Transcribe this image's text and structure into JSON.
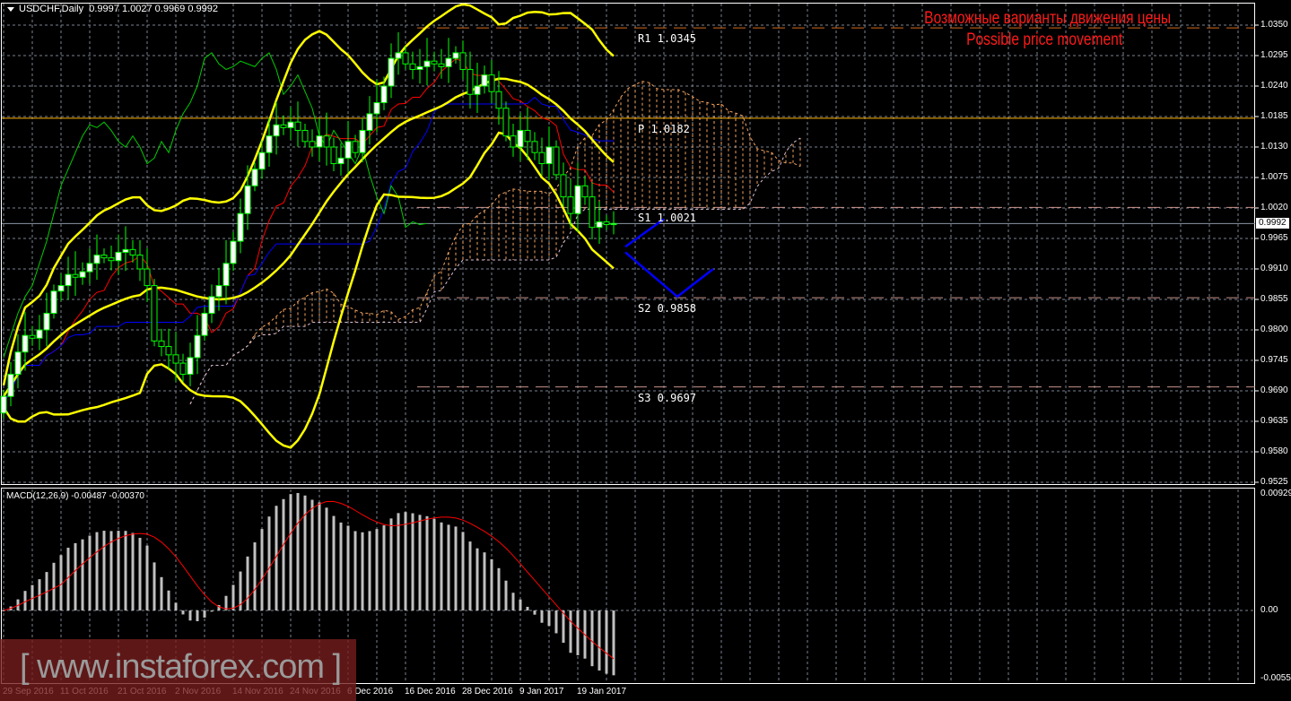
{
  "header": {
    "symbol": "USDCHF,Daily",
    "ohlc": "0.9997 1.0027 0.9969 0.9992"
  },
  "macd_label": "MACD(12,26,9) -0.00487 -0.00370",
  "price_axis": [
    "1.0350",
    "1.0295",
    "1.0240",
    "1.0185",
    "1.0130",
    "1.0075",
    "1.0020",
    "0.9965",
    "0.9910",
    "0.9855",
    "0.9800",
    "0.9745",
    "0.9690",
    "0.9635",
    "0.9580",
    "0.9525"
  ],
  "current_price": "0.9992",
  "macd_axis": [
    "0.00929",
    "0.00",
    "-0.00554"
  ],
  "dates": [
    "29 Sep 2016",
    "11 Oct 2016",
    "21 Oct 2016",
    "2 Nov 2016",
    "14 Nov 2016",
    "24 Nov 2016",
    "6 Dec 2016",
    "16 Dec 2016",
    "28 Dec 2016",
    "9 Jan 2017",
    "19 Jan 2017"
  ],
  "pivots": [
    {
      "label": "R1 1.0345",
      "value": 1.0345,
      "color": "#d2691e"
    },
    {
      "label": "P 1.0182",
      "value": 1.0182,
      "color": "#ffb300"
    },
    {
      "label": "S1 1.0021",
      "value": 1.0021,
      "color": "#c8928a"
    },
    {
      "label": "S2 0.9858",
      "value": 0.9858,
      "color": "#c8928a"
    },
    {
      "label": "S3 0.9697",
      "value": 0.9697,
      "color": "#c8928a"
    }
  ],
  "annotation": {
    "ru": "Возможные варианты движения цены",
    "en": "Possible price movement",
    "color": "#ff1a1a"
  },
  "watermark": "[ www.instaforex.com ]",
  "chart_data": {
    "type": "candlestick",
    "title": "USDCHF,Daily",
    "ylim": [
      0.9525,
      1.035
    ],
    "macd_ylim": [
      -0.00554,
      0.00929
    ],
    "closes": [
      0.968,
      0.972,
      0.976,
      0.979,
      0.9785,
      0.98,
      0.983,
      0.987,
      0.988,
      0.99,
      0.9895,
      0.9905,
      0.992,
      0.9935,
      0.993,
      0.9925,
      0.994,
      0.9945,
      0.9935,
      0.991,
      0.988,
      0.978,
      0.977,
      0.9755,
      0.974,
      0.972,
      0.975,
      0.979,
      0.983,
      0.986,
      0.988,
      0.992,
      0.996,
      1.001,
      1.006,
      1.009,
      1.012,
      1.015,
      1.017,
      1.0165,
      1.0175,
      1.016,
      1.014,
      1.013,
      1.015,
      1.013,
      1.01,
      1.011,
      1.014,
      1.012,
      1.016,
      1.019,
      1.021,
      1.024,
      1.029,
      1.03,
      1.028,
      1.027,
      1.0275,
      1.0285,
      1.028,
      1.0275,
      1.029,
      1.03,
      1.027,
      1.0225,
      1.024,
      1.026,
      1.023,
      1.02,
      1.015,
      1.013,
      1.016,
      1.014,
      1.012,
      1.01,
      1.013,
      1.008,
      1.004,
      1.001,
      1.006,
      1.004,
      0.9985,
      0.9995,
      0.999,
      0.9992
    ],
    "projection_up": [
      0.995,
      1.0
    ],
    "projection_down": [
      0.994,
      0.986,
      0.991
    ],
    "indicators": [
      "Bollinger Bands (20,2)",
      "Ichimoku",
      "MACD(12,26,9)",
      "Pivot Points"
    ],
    "colors": {
      "bull": "#ffffff",
      "bear": "#000000",
      "wick": "#00ff00",
      "bands": "#ffff00",
      "tenkan": "#ff0000",
      "kijun": "#0000ff",
      "chikou": "#00cc00",
      "cloud": "#f4a460",
      "macd_hist": "#c0c0c0",
      "macd_signal": "#ff0000"
    }
  }
}
